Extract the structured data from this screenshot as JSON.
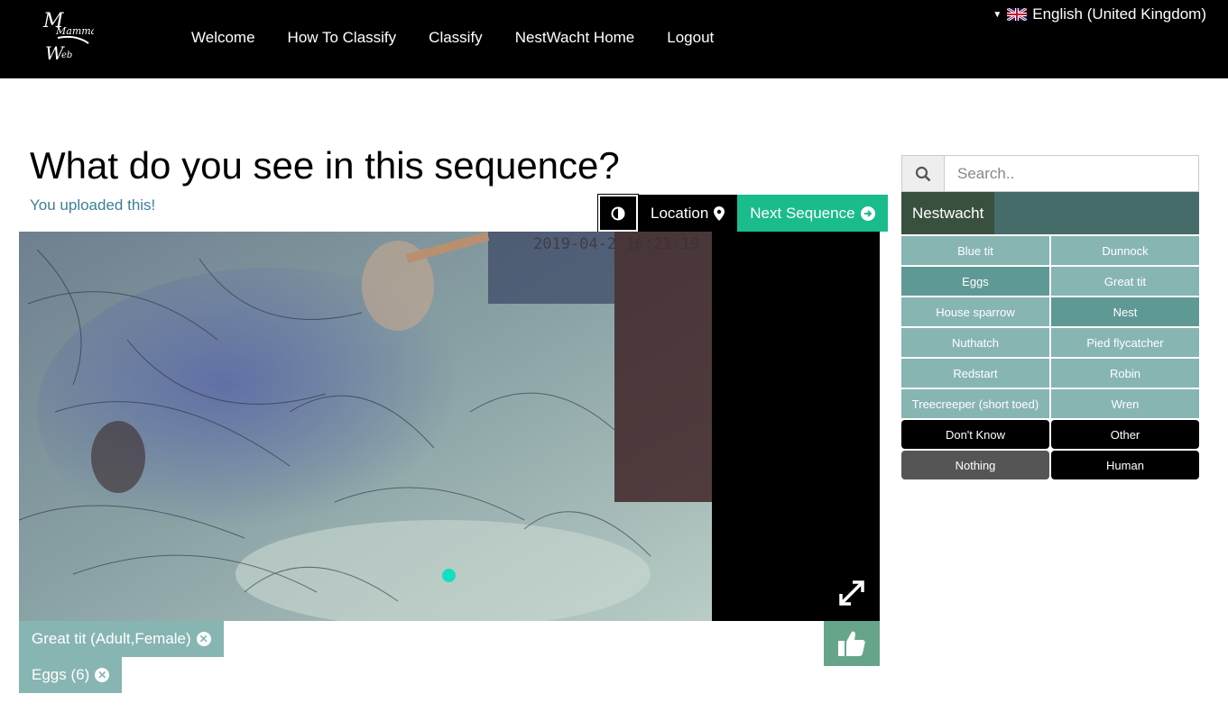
{
  "nav": {
    "logo_text": "Mammal Web",
    "items": [
      "Welcome",
      "How To Classify",
      "Classify",
      "NestWacht Home",
      "Logout"
    ],
    "language": "English (United Kingdom)"
  },
  "main": {
    "title": "What do you see in this sequence?",
    "uploaded_note": "You uploaded this!",
    "location_label": "Location",
    "next_label": "Next Sequence",
    "timestamp": "2019-04-2  16:21:19"
  },
  "tags": [
    {
      "label": "Great tit (Adult,Female)"
    },
    {
      "label": "Eggs (6)"
    }
  ],
  "panel": {
    "search_placeholder": "Search..",
    "tab": "Nestwacht",
    "species": [
      {
        "label": "Blue tit",
        "tone": "light"
      },
      {
        "label": "Dunnock",
        "tone": "light"
      },
      {
        "label": "Eggs",
        "tone": "dark"
      },
      {
        "label": "Great tit",
        "tone": "light"
      },
      {
        "label": "House sparrow",
        "tone": "light"
      },
      {
        "label": "Nest",
        "tone": "dark"
      },
      {
        "label": "Nuthatch",
        "tone": "light"
      },
      {
        "label": "Pied flycatcher",
        "tone": "light"
      },
      {
        "label": "Redstart",
        "tone": "light"
      },
      {
        "label": "Robin",
        "tone": "light"
      },
      {
        "label": "Treecreeper (short toed)",
        "tone": "light"
      },
      {
        "label": "Wren",
        "tone": "light"
      }
    ],
    "extra": [
      {
        "label": "Don't Know",
        "tone": "black"
      },
      {
        "label": "Other",
        "tone": "black"
      },
      {
        "label": "Nothing",
        "tone": "grey"
      },
      {
        "label": "Human",
        "tone": "black"
      }
    ]
  },
  "colors": {
    "topbar": "#000000",
    "accent_green": "#1abc8c",
    "tag": "#87b5b2",
    "tab_bar": "#466c6a",
    "link": "#3d7f9a"
  }
}
